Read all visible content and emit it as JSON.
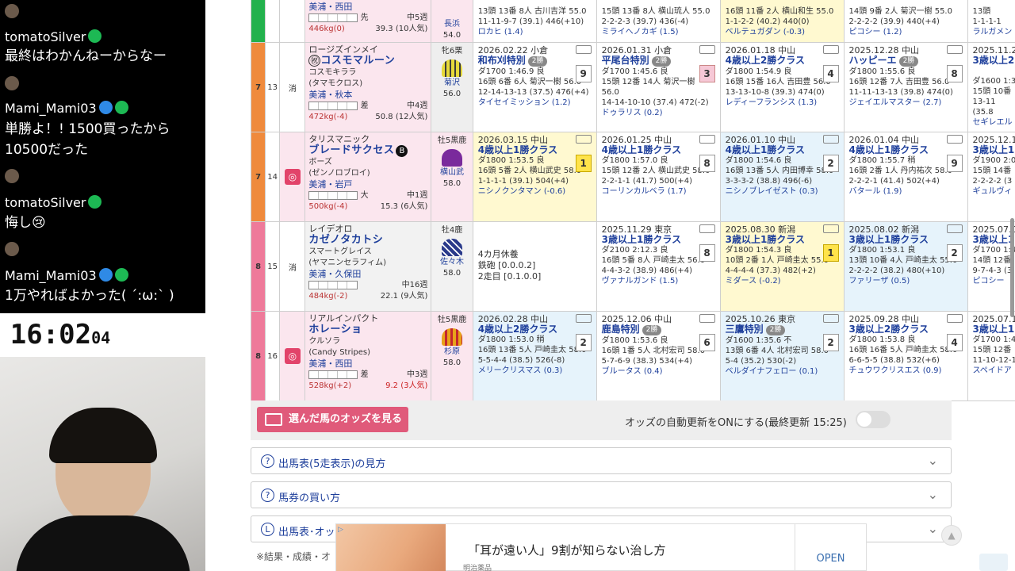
{
  "chat": {
    "messages": [
      {
        "user": "tomatoSilver",
        "text": "最終はわかんねーからなー"
      },
      {
        "user": "Mami_Mami03",
        "text": "単勝よ！! 1500買ったから10500だった"
      },
      {
        "user": "tomatoSilver",
        "text": "悔し😢"
      },
      {
        "user": "Mami_Mami03",
        "text": "1万やればよかった( ´:ω:` )"
      }
    ]
  },
  "clock": {
    "hm": "16:02",
    "sec": "04"
  },
  "top_row": {
    "trainer": "美浦・西田",
    "hist": "中5週",
    "bw": "446kg(0)",
    "odds": "39.3 (10人気)",
    "jockey": "長浜",
    "kg": "54.0",
    "races": [
      {
        "l1": "13頭 13番 8人 古川吉洋 55.0",
        "l2": "11-11-9-7 (39.1) 446(+10)",
        "winner": "ロカヒ (1.4)"
      },
      {
        "l1": "15頭 13番 8人 横山琉人 55.0",
        "l2": "2-2-2-3 (39.7) 436(-4)",
        "winner": "ミライヘノカギ (1.5)"
      },
      {
        "l1": "16頭 11番 2人 横山和生 55.0",
        "l2": "1-1-2-2 (40.2) 440(0)",
        "winner": "ベルテュガダン (-0.3)"
      },
      {
        "l1": "14頭 9番 2人 菊沢一樹 55.0",
        "l2": "2-2-2-2 (39.9) 440(+4)",
        "winner": "ピコシー (1.2)"
      },
      {
        "l1": "13頭",
        "l2": "1-1-1-1",
        "winner": "ラルガメン"
      }
    ]
  },
  "horses": [
    {
      "waku": "7",
      "num": "13",
      "mark": "消",
      "sire": "ロージズインメイ",
      "name": "コスモマルーン",
      "dam": "コスモキララ",
      "damsire": "(タマモクロス)",
      "trainer": "美浦・秋本",
      "style": "差",
      "hist": "中4週",
      "bw": "472kg(-4)",
      "odds": "50.8 (12人気)",
      "sex": "牝6栗",
      "jockey": "菊沢",
      "kg": "56.0",
      "races": [
        {
          "date": "2026.02.22 小倉",
          "name": "和布刈特別",
          "tag": "2勝",
          "rank": "9",
          "l1": "ダ1700 1:46.9 良",
          "l2": "16頭 6番 6人 菊沢一樹 56.0",
          "l3": "12-14-13-13 (37.5) 476(+4)",
          "winner": "タイセイミッション (1.2)"
        },
        {
          "date": "2026.01.31 小倉",
          "name": "平尾台特別",
          "tag": "2勝",
          "rank": "3",
          "l1": "ダ1700 1:45.6 良",
          "l2": "15頭 12番 14人 菊沢一樹 56.0",
          "l3": "14-14-10-10 (37.4) 472(-2)",
          "winner": "ドゥラリス (0.2)"
        },
        {
          "date": "2026.01.18 中山",
          "name": "4歳以上2勝クラス",
          "tag": "",
          "rank": "4",
          "l1": "ダ1800 1:54.9 良",
          "l2": "16頭 15番 16人 吉田豊 56.0",
          "l3": "13-13-10-8 (39.3) 474(0)",
          "winner": "レディーフランシス (1.3)"
        },
        {
          "date": "2025.12.28 中山",
          "name": "ハッピーエ",
          "tag": "2勝",
          "rank": "8",
          "l1": "ダ1800 1:55.6 良",
          "l2": "16頭 12番 7人 吉田豊 56.0",
          "l3": "11-11-13-13 (39.8) 474(0)",
          "winner": "ジェイエルマスター (2.7)"
        },
        {
          "date": "2025.11.23",
          "name": "3歳以上2",
          "tag": "",
          "rank": "",
          "l1": "ダ1600 1:3",
          "l2": "15頭 10番",
          "l3": "13-11 (35.8",
          "winner": "セギレエル"
        }
      ]
    },
    {
      "waku": "7",
      "num": "14",
      "mark": "◎",
      "sire": "タリスマニック",
      "name": "ブレードサクセス",
      "dam": "ボーズ",
      "damsire": "(ゼンノロブロイ)",
      "trainer": "美浦・岩戸",
      "style": "大",
      "hist": "中1週",
      "bw": "500kg(-4)",
      "odds": "15.3 (6人気)",
      "sex": "牡5黒鹿",
      "jockey": "横山武",
      "kg": "58.0",
      "races": [
        {
          "date": "2026.03.15 中山",
          "name": "4歳以上1勝クラス",
          "tag": "",
          "rank": "1",
          "l1": "ダ1800 1:53.5 良",
          "l2": "16頭 5番 2人 横山武史 58.0",
          "l3": "1-1-1-1 (39.1) 504(+4)",
          "winner": "ニシノクンタマン (-0.6)"
        },
        {
          "date": "2026.01.25 中山",
          "name": "4歳以上1勝クラス",
          "tag": "",
          "rank": "8",
          "l1": "ダ1800 1:57.0 良",
          "l2": "15頭 12番 2人 横山武史 58.0",
          "l3": "2-2-1-1 (41.7) 500(+4)",
          "winner": "コーリンカルベラ (1.7)"
        },
        {
          "date": "2026.01.10 中山",
          "name": "4歳以上1勝クラス",
          "tag": "",
          "rank": "2",
          "l1": "ダ1800 1:54.6 良",
          "l2": "16頭 13番 5人 内田博幸 58.0",
          "l3": "3-3-3-2 (38.8) 496(-6)",
          "winner": "ニシノブレイゼスト (0.3)"
        },
        {
          "date": "2026.01.04 中山",
          "name": "4歳以上1勝クラス",
          "tag": "",
          "rank": "9",
          "l1": "ダ1800 1:55.7 稍",
          "l2": "16頭 2番 1人 丹内祐次 58.0",
          "l3": "2-2-2-1 (41.4) 502(+4)",
          "winner": "バタール (1.9)"
        },
        {
          "date": "2025.12.13",
          "name": "3歳以上1",
          "tag": "",
          "rank": "",
          "l1": "ダ1900 2:0",
          "l2": "15頭 14番",
          "l3": "2-2-2-2 (3",
          "winner": "ギュルヴィ"
        }
      ]
    },
    {
      "waku": "8",
      "num": "15",
      "mark": "消",
      "sire": "レイデオロ",
      "name": "カゼノタカトシ",
      "dam": "スマートグレイス",
      "damsire": "(ヤマニンセラフィム)",
      "trainer": "美浦・久保田",
      "style": "",
      "hist": "中16週",
      "bw": "484kg(-2)",
      "odds": "22.1 (9人気)",
      "sex": "牡4鹿",
      "jockey": "佐々木",
      "kg": "58.0",
      "rest": [
        "4カ月休養",
        "鉄砲 [0.0.0.2]",
        "2走目 [0.1.0.0]"
      ],
      "races": [
        {
          "date": "2025.11.29 東京",
          "name": "3歳以上1勝クラス",
          "tag": "",
          "rank": "8",
          "l1": "ダ2100 2:12.3 良",
          "l2": "16頭 5番 8人 戸崎圭太 56.0",
          "l3": "4-4-3-2 (38.9) 486(+4)",
          "winner": "ヴァナルガンド (1.5)"
        },
        {
          "date": "2025.08.30 新潟",
          "name": "3歳以上1勝クラス",
          "tag": "",
          "rank": "1",
          "l1": "ダ1800 1:54.3 良",
          "l2": "10頭 2番 1人 戸崎圭太 55.0",
          "l3": "4-4-4-4 (37.3) 482(+2)",
          "winner": "ミダース (-0.2)"
        },
        {
          "date": "2025.08.02 新潟",
          "name": "3歳以上1勝クラス",
          "tag": "",
          "rank": "2",
          "l1": "ダ1800 1:53.1 良",
          "l2": "13頭 10番 4人 戸崎圭太 55.0",
          "l3": "2-2-2-2 (38.2) 480(+10)",
          "winner": "ファリーザ (0.5)"
        },
        {
          "date": "2025.07.05",
          "name": "3歳以上1",
          "tag": "",
          "rank": "",
          "l1": "ダ1700 1:4",
          "l2": "14頭 12番",
          "l3": "9-7-4-3 (3",
          "winner": "ピコシー"
        }
      ]
    },
    {
      "waku": "8",
      "num": "16",
      "mark": "◎",
      "sire": "リアルインパクト",
      "name": "ホレーショ",
      "dam": "クルソラ",
      "damsire": "(Candy Stripes)",
      "trainer": "美浦・西田",
      "style": "差",
      "hist": "中3週",
      "bw": "528kg(+2)",
      "odds": "9.2 (3人気)",
      "sex": "牡5黒鹿",
      "jockey": "杉原",
      "kg": "58.0",
      "races": [
        {
          "date": "2026.02.28 中山",
          "name": "4歳以上2勝クラス",
          "tag": "",
          "rank": "2",
          "l1": "ダ1800 1:53.0 稍",
          "l2": "16頭 13番 5人 戸崎圭太 58.0",
          "l3": "5-5-4-4 (38.5) 526(-8)",
          "winner": "メリークリスマス (0.3)"
        },
        {
          "date": "2025.12.06 中山",
          "name": "鹿島特別",
          "tag": "2勝",
          "rank": "6",
          "l1": "ダ1800 1:53.6 良",
          "l2": "16頭 1番 5人 北村宏司 58.0",
          "l3": "5-7-6-9 (38.3) 534(+4)",
          "winner": "ブルータス (0.4)"
        },
        {
          "date": "2025.10.26 東京",
          "name": "三鷹特別",
          "tag": "2勝",
          "rank": "2",
          "l1": "ダ1600 1:35.6 不",
          "l2": "13頭 6番 4人 北村宏司 58.0",
          "l3": "5-4 (35.2) 530(-2)",
          "winner": "ベルダイナフェロー (0.1)"
        },
        {
          "date": "2025.09.28 中山",
          "name": "3歳以上2勝クラス",
          "tag": "",
          "rank": "4",
          "l1": "ダ1800 1:53.8 良",
          "l2": "16頭 16番 5人 戸崎圭太 58.0",
          "l3": "6-6-5-5 (38.8) 532(+6)",
          "winner": "チュウワクリスエス (0.9)"
        },
        {
          "date": "2025.07.12",
          "name": "3歳以上1",
          "tag": "",
          "rank": "",
          "l1": "ダ1700 1:4",
          "l2": "15頭 12番",
          "l3": "11-10-12-1",
          "winner": "スペイドア"
        }
      ]
    }
  ],
  "odds_bar": {
    "button": "選んだ馬のオッズを見る",
    "auto": "オッズの自動更新をONにする(最終更新 15:25)"
  },
  "accordions": [
    {
      "icon": "?",
      "label": "出馬表(5走表示)の見方"
    },
    {
      "icon": "?",
      "label": "馬券の買い方"
    },
    {
      "icon": "L",
      "label": "出馬表･オッ"
    }
  ],
  "footnote": "※結果・成績・オ",
  "ad": {
    "text": "「耳が遠い人」9割が知らない治し方",
    "sponsor": "明治薬品",
    "open": "OPEN"
  },
  "colors": {
    "waku7": "#ef8a3c",
    "waku8": "#ee7a9a",
    "top_waku": "#22b14c"
  }
}
